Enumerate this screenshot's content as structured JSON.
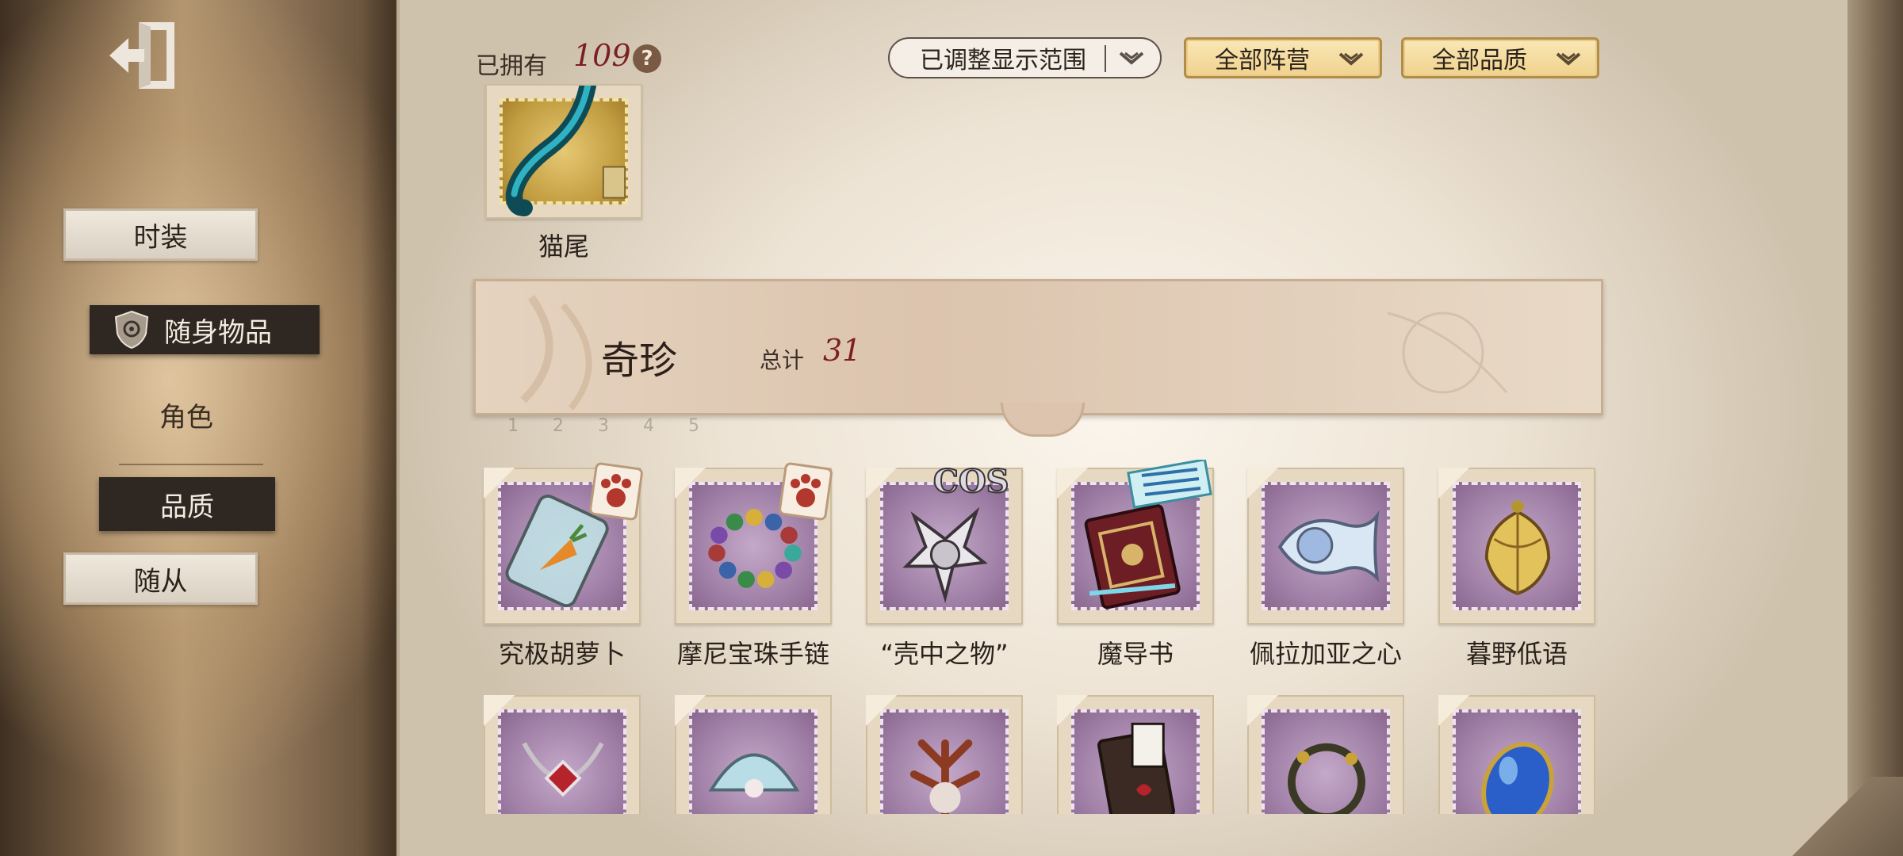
{
  "sidebar": {
    "exit_icon": "exit-door-icon",
    "tabs": [
      {
        "label": "时装",
        "style": "paper"
      },
      {
        "label": "随身物品",
        "style": "dark",
        "icon": "shield-emblem-icon",
        "selected": true
      },
      {
        "label": "角色",
        "style": "plain"
      },
      {
        "label": "品质",
        "style": "dark"
      },
      {
        "label": "随从",
        "style": "paper"
      }
    ]
  },
  "header": {
    "owned_label": "已拥有",
    "owned_count": "109",
    "help_icon": "question-icon",
    "filters": {
      "range": "已调整显示范围",
      "camp": "全部阵营",
      "quality": "全部品质"
    }
  },
  "top_item": {
    "label": "猫尾",
    "icon": "cat-tail-icon"
  },
  "category": {
    "title": "奇珍",
    "total_label": "总计",
    "total": "31"
  },
  "ruler_text": "1 2 3 4 5",
  "items_row1": [
    {
      "label": "究极胡萝卜",
      "icon": "carrot-jar-icon",
      "badge": "paw-badge-icon"
    },
    {
      "label": "摩尼宝珠手链",
      "icon": "bead-bracelet-icon",
      "badge": "paw-badge-icon"
    },
    {
      "label": "“壳中之物”",
      "icon": "shell-creature-icon",
      "badge": "cos-logo-badge"
    },
    {
      "label": "魔导书",
      "icon": "grimoire-icon",
      "badge": "ticket-badge"
    },
    {
      "label": "佩拉加亚之心",
      "icon": "fish-heart-icon"
    },
    {
      "label": "暮野低语",
      "icon": "golden-pendant-icon"
    }
  ],
  "items_row2": [
    {
      "icon": "necklace-icon"
    },
    {
      "icon": "pearl-shell-icon"
    },
    {
      "icon": "coral-figure-icon"
    },
    {
      "icon": "card-deck-icon"
    },
    {
      "icon": "branch-wreath-icon"
    },
    {
      "icon": "blue-gem-heart-icon"
    }
  ],
  "colors": {
    "accent_count": "#7c1f24",
    "stamp_purple": "#9e7da4",
    "dark_tab": "#2e2722",
    "gold_filter": "#f0d28d"
  }
}
